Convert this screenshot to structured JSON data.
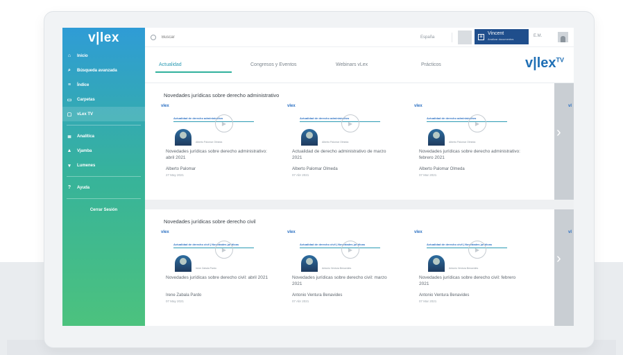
{
  "sidebar": {
    "logo": "v|lex",
    "items": [
      {
        "label": "Inicio",
        "icon": "home-icon"
      },
      {
        "label": "Búsqueda avanzada",
        "icon": "search-icon"
      },
      {
        "label": "Índice",
        "icon": "index-icon"
      },
      {
        "label": "Carpetas",
        "icon": "folder-icon"
      },
      {
        "label": "vLex TV",
        "icon": "tv-icon"
      },
      {
        "label": "Analítica",
        "icon": "analytics-icon"
      },
      {
        "label": "Vjamba",
        "icon": "chart-icon"
      },
      {
        "label": "Lumenes",
        "icon": "pin-icon"
      },
      {
        "label": "Ayuda",
        "icon": "help-icon"
      }
    ],
    "logout_label": "Cerrar Sesión"
  },
  "topbar": {
    "search_placeholder": "Buscar",
    "language": "España",
    "vincent_label": "Vincent",
    "vincent_sub": "Analizar documentos",
    "user_initials": "E.M."
  },
  "tabs": [
    {
      "label": "Actualidad",
      "active": true
    },
    {
      "label": "Congresos y Eventos",
      "active": false
    },
    {
      "label": "Webinars vLex",
      "active": false
    },
    {
      "label": "Prácticos",
      "active": false
    }
  ],
  "tv_logo": "v|lex",
  "tv_sup": "TV",
  "sections": [
    {
      "title": "Novedades jurídicas sobre derecho administrativo",
      "cards": [
        {
          "brand": "vlex",
          "sub": "Actualidad de derecho administrativo",
          "caption": "Alberto Palomar Olmeda",
          "title": "Novedades jurídicas sobre derecho administrativo: abril 2021",
          "author": "Alberto Palomar",
          "date": "27 May 2021"
        },
        {
          "brand": "vlex",
          "sub": "Actualidad de derecho administrativo",
          "caption": "Alberto Palomar Olmeda",
          "title": "Actualidad de derecho administrativo de marzo 2021",
          "author": "Alberto Palomar Olmeda",
          "date": "07 Abr 2021"
        },
        {
          "brand": "vlex",
          "sub": "Actualidad de derecho administrativo",
          "caption": "Alberto Palomar Olmeda",
          "title": "Novedades jurídicas sobre derecho administrativo: febrero 2021",
          "author": "Alberto Palomar Olmeda",
          "date": "07 Mar 2021"
        }
      ]
    },
    {
      "title": "Novedades jurídicas sobre derecho civil",
      "cards": [
        {
          "brand": "vlex",
          "sub": "Actualidad de derecho civil | Novedades jurídicas",
          "caption": "Irene Zabala Pardo",
          "title": "Novedades jurídicas sobre derecho civil: abril 2021",
          "author": "Irene Zabala Pardo",
          "date": "07 May 2021"
        },
        {
          "brand": "vlex",
          "sub": "Actualidad de derecho civil | Novedades jurídicas",
          "caption": "Antonio Ventura Benavides",
          "title": "Novedades jurídicas sobre derecho civil: marzo 2021",
          "author": "Antonio Ventura Benavides",
          "date": "07 Abr 2021"
        },
        {
          "brand": "vlex",
          "sub": "Actualidad de derecho civil | Novedades jurídicas",
          "caption": "Antonio Ventura Benavides",
          "title": "Novedades jurídicas sobre derecho civil: febrero 2021",
          "author": "Antonio Ventura Benavides",
          "date": "07 Mar 2021"
        }
      ]
    }
  ],
  "colors": {
    "sidebar_top": "#2f9cd6",
    "sidebar_bottom": "#4cc27e",
    "accent": "#2a9ab3",
    "brand_blue": "#1f6fb5",
    "vincent_bg": "#1f4e8c"
  }
}
